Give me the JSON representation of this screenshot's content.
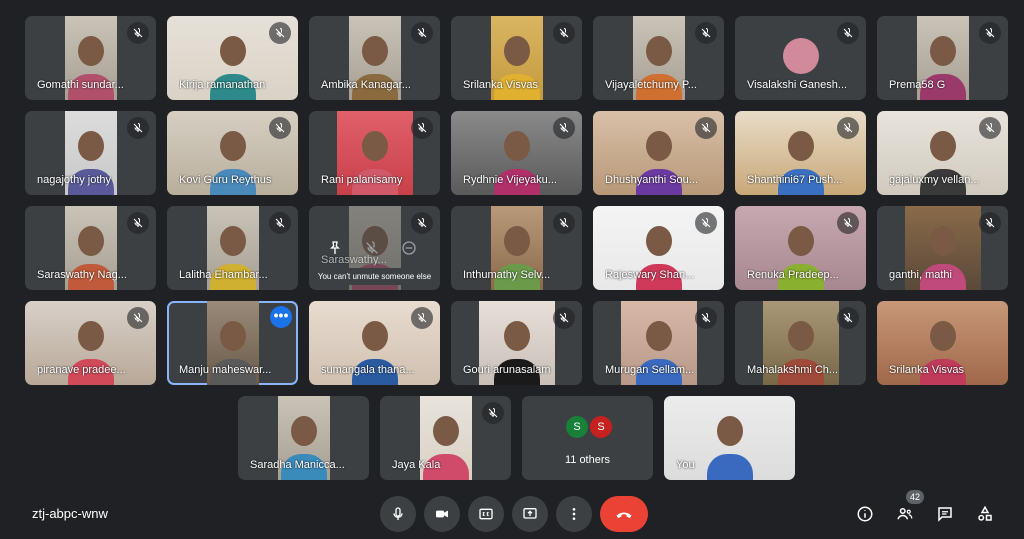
{
  "participants": [
    {
      "name": "Gomathi sundar..."
    },
    {
      "name": "Kirija ramanathan"
    },
    {
      "name": "Ambika Kanagar..."
    },
    {
      "name": "Srilanka Visvas"
    },
    {
      "name": "Vijayaletchumy P..."
    },
    {
      "name": "Visalakshi Ganesh..."
    },
    {
      "name": "Prema58 G"
    },
    {
      "name": "nagajothy jothy"
    },
    {
      "name": "Kovi Guru Reythus"
    },
    {
      "name": "Rani palanisamy"
    },
    {
      "name": "Rydhnie Vijeyaku..."
    },
    {
      "name": "Dhushyanthi Sou..."
    },
    {
      "name": "Shanthini67 Push..."
    },
    {
      "name": "gajaluxmy vellan..."
    },
    {
      "name": "Saraswathy Nag..."
    },
    {
      "name": "Lalitha Ehambar..."
    },
    {
      "name": "Saraswathy..."
    },
    {
      "name": "Inthumathy Selv..."
    },
    {
      "name": "Rajeswary Shan..."
    },
    {
      "name": "Renuka Pradeep..."
    },
    {
      "name": "ganthi, mathi"
    },
    {
      "name": "piranave pradee..."
    },
    {
      "name": "Manju maheswar..."
    },
    {
      "name": "sumangala thana..."
    },
    {
      "name": "Gouri arunasalam"
    },
    {
      "name": "Murugan Sellam..."
    },
    {
      "name": "Mahalakshmi Ch..."
    },
    {
      "name": "Srilanka Visvas"
    },
    {
      "name": "Saradha Manicca..."
    },
    {
      "name": "Jaya Kala"
    },
    {
      "name": "You"
    }
  ],
  "others_tile": {
    "initial_1": "S",
    "initial_2": "S",
    "label": "11 others"
  },
  "tooltip": "You can't unmute someone else",
  "more_glyph": "•••",
  "meeting_code": "ztj-abpc-wnw",
  "people_count": "42",
  "colors": {
    "background": "#202124",
    "tile": "#3c4043",
    "end_call": "#ea4335",
    "highlight": "#8ab4f8"
  },
  "icons": [
    "mic-icon",
    "videocam-icon",
    "captions-icon",
    "present-icon",
    "more-vert-icon",
    "call-end-icon",
    "info-icon",
    "people-icon",
    "chat-icon",
    "activities-icon",
    "mic-off-icon",
    "pin-icon"
  ]
}
